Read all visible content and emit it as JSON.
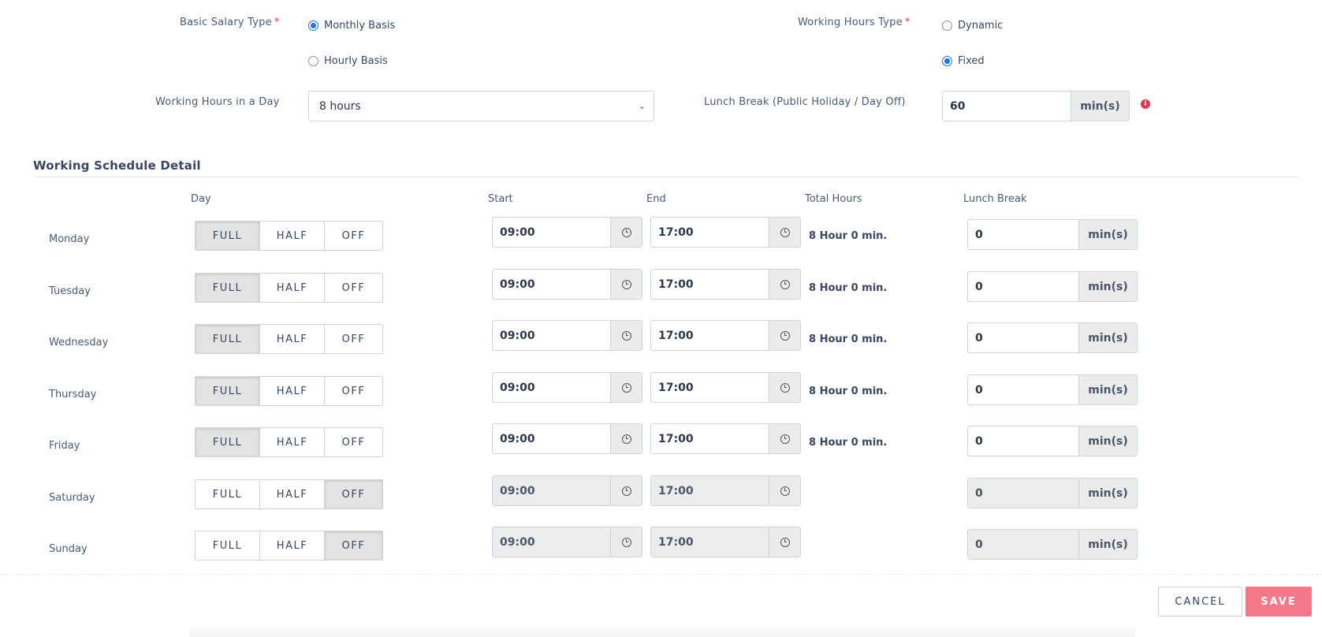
{
  "form": {
    "basic_salary": {
      "label": "Basic Salary Type",
      "required_mark": "*",
      "options": [
        {
          "label": "Monthly Basis",
          "checked": true
        },
        {
          "label": "Hourly Basis",
          "checked": false
        }
      ]
    },
    "working_hours_type": {
      "label": "Working Hours Type",
      "required_mark": "*",
      "options": [
        {
          "label": "Dynamic",
          "checked": false
        },
        {
          "label": "Fixed",
          "checked": true
        }
      ]
    },
    "hours_in_day": {
      "label": "Working Hours in a Day",
      "value": "8 hours"
    },
    "lunch_break_holiday": {
      "label": "Lunch Break (Public Holiday / Day Off)",
      "value": "60",
      "unit": "min(s)",
      "info_icon": "info-icon"
    }
  },
  "schedule": {
    "title": "Working Schedule Detail",
    "columns": {
      "day": "Day",
      "start": "Start",
      "end": "End",
      "total": "Total Hours",
      "lunch": "Lunch Break"
    },
    "segment_labels": [
      "FULL",
      "HALF",
      "OFF"
    ],
    "rows": [
      {
        "day": "Monday",
        "mode": "FULL",
        "start": "09:00",
        "end": "17:00",
        "total": "8 Hour 0 min.",
        "lunch": "0",
        "unit": "min(s)",
        "disabled": false
      },
      {
        "day": "Tuesday",
        "mode": "FULL",
        "start": "09:00",
        "end": "17:00",
        "total": "8 Hour 0 min.",
        "lunch": "0",
        "unit": "min(s)",
        "disabled": false
      },
      {
        "day": "Wednesday",
        "mode": "FULL",
        "start": "09:00",
        "end": "17:00",
        "total": "8 Hour 0 min.",
        "lunch": "0",
        "unit": "min(s)",
        "disabled": false
      },
      {
        "day": "Thursday",
        "mode": "FULL",
        "start": "09:00",
        "end": "17:00",
        "total": "8 Hour 0 min.",
        "lunch": "0",
        "unit": "min(s)",
        "disabled": false
      },
      {
        "day": "Friday",
        "mode": "FULL",
        "start": "09:00",
        "end": "17:00",
        "total": "8 Hour 0 min.",
        "lunch": "0",
        "unit": "min(s)",
        "disabled": false
      },
      {
        "day": "Saturday",
        "mode": "OFF",
        "start": "09:00",
        "end": "17:00",
        "total": "",
        "lunch": "0",
        "unit": "min(s)",
        "disabled": true
      },
      {
        "day": "Sunday",
        "mode": "OFF",
        "start": "09:00",
        "end": "17:00",
        "total": "",
        "lunch": "0",
        "unit": "min(s)",
        "disabled": true
      }
    ]
  },
  "actions": {
    "cancel_label": "CANCEL",
    "save_label": "SAVE"
  },
  "colors": {
    "accent": "#1a73e8",
    "required": "#e5344f",
    "save": "#f4788a"
  }
}
